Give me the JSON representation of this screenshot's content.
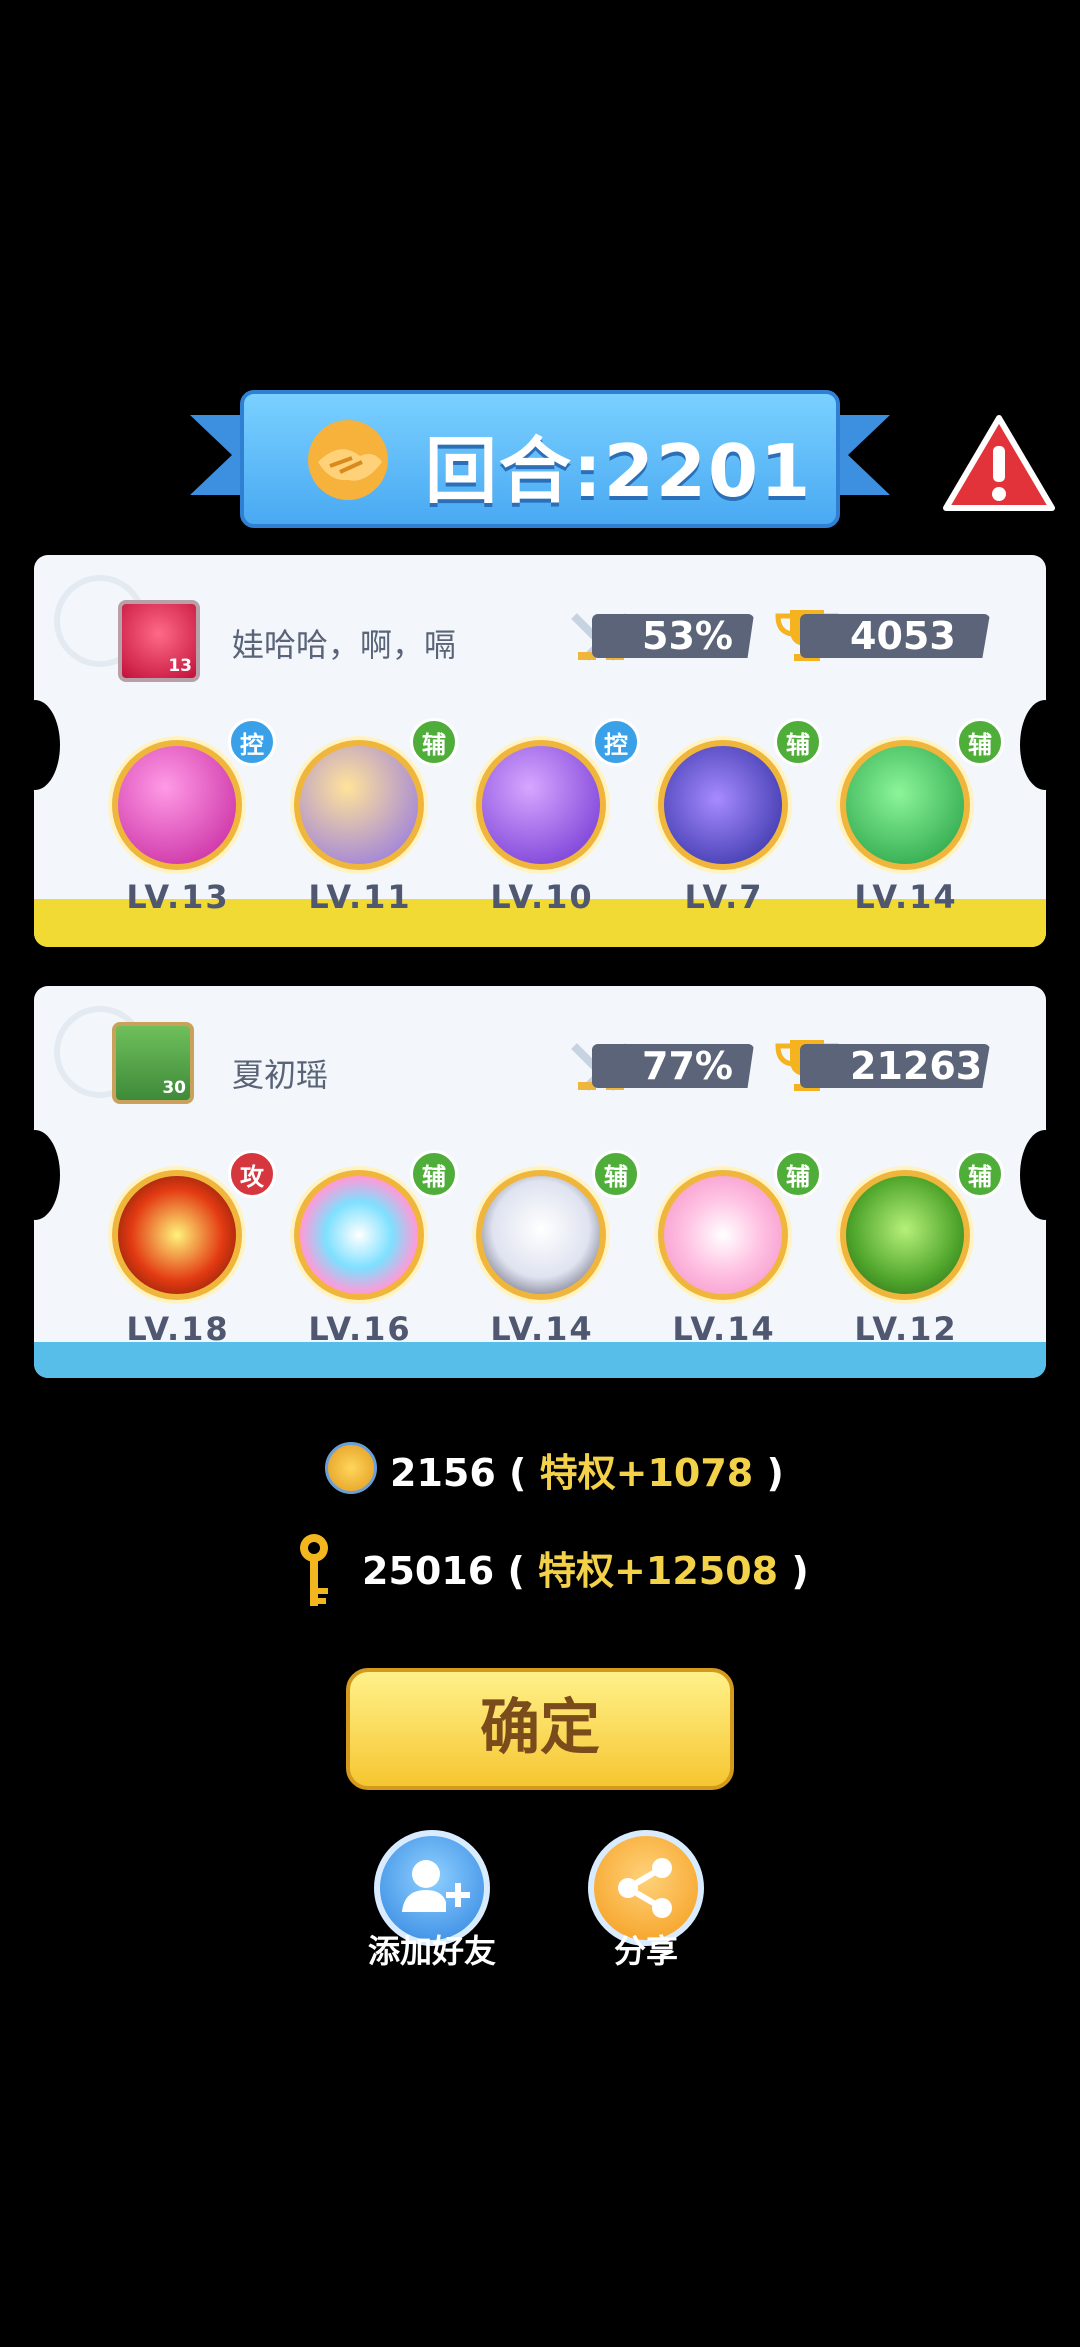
{
  "header": {
    "round_text": "回合:2201"
  },
  "players": [
    {
      "name": "娃哈哈，啊，嗝",
      "avatar_level": "13",
      "win_rate": "53%",
      "trophies": "4053",
      "strip_color": "#f1da34",
      "heroes": [
        {
          "badge": "控",
          "badge_color": "#3aa1e8",
          "level": "LV.13"
        },
        {
          "badge": "辅",
          "badge_color": "#4fae3a",
          "level": "LV.11"
        },
        {
          "badge": "控",
          "badge_color": "#3aa1e8",
          "level": "LV.10"
        },
        {
          "badge": "辅",
          "badge_color": "#4fae3a",
          "level": "LV.7"
        },
        {
          "badge": "辅",
          "badge_color": "#4fae3a",
          "level": "LV.14"
        }
      ]
    },
    {
      "name": "夏初瑶",
      "avatar_level": "30",
      "win_rate": "77%",
      "trophies": "21263",
      "strip_color": "#57bde9",
      "heroes": [
        {
          "badge": "攻",
          "badge_color": "#d6363d",
          "level": "LV.18"
        },
        {
          "badge": "辅",
          "badge_color": "#4fae3a",
          "level": "LV.16"
        },
        {
          "badge": "辅",
          "badge_color": "#4fae3a",
          "level": "LV.14"
        },
        {
          "badge": "辅",
          "badge_color": "#4fae3a",
          "level": "LV.14"
        },
        {
          "badge": "辅",
          "badge_color": "#4fae3a",
          "level": "LV.12"
        }
      ]
    }
  ],
  "rewards": {
    "coins": "2156",
    "coins_bonus": "特权+1078",
    "keys": "25016",
    "keys_bonus": "特权+12508",
    "open_paren": "(",
    "close_paren": ")"
  },
  "buttons": {
    "confirm": "确定",
    "add_friend": "添加好友",
    "share": "分享"
  }
}
